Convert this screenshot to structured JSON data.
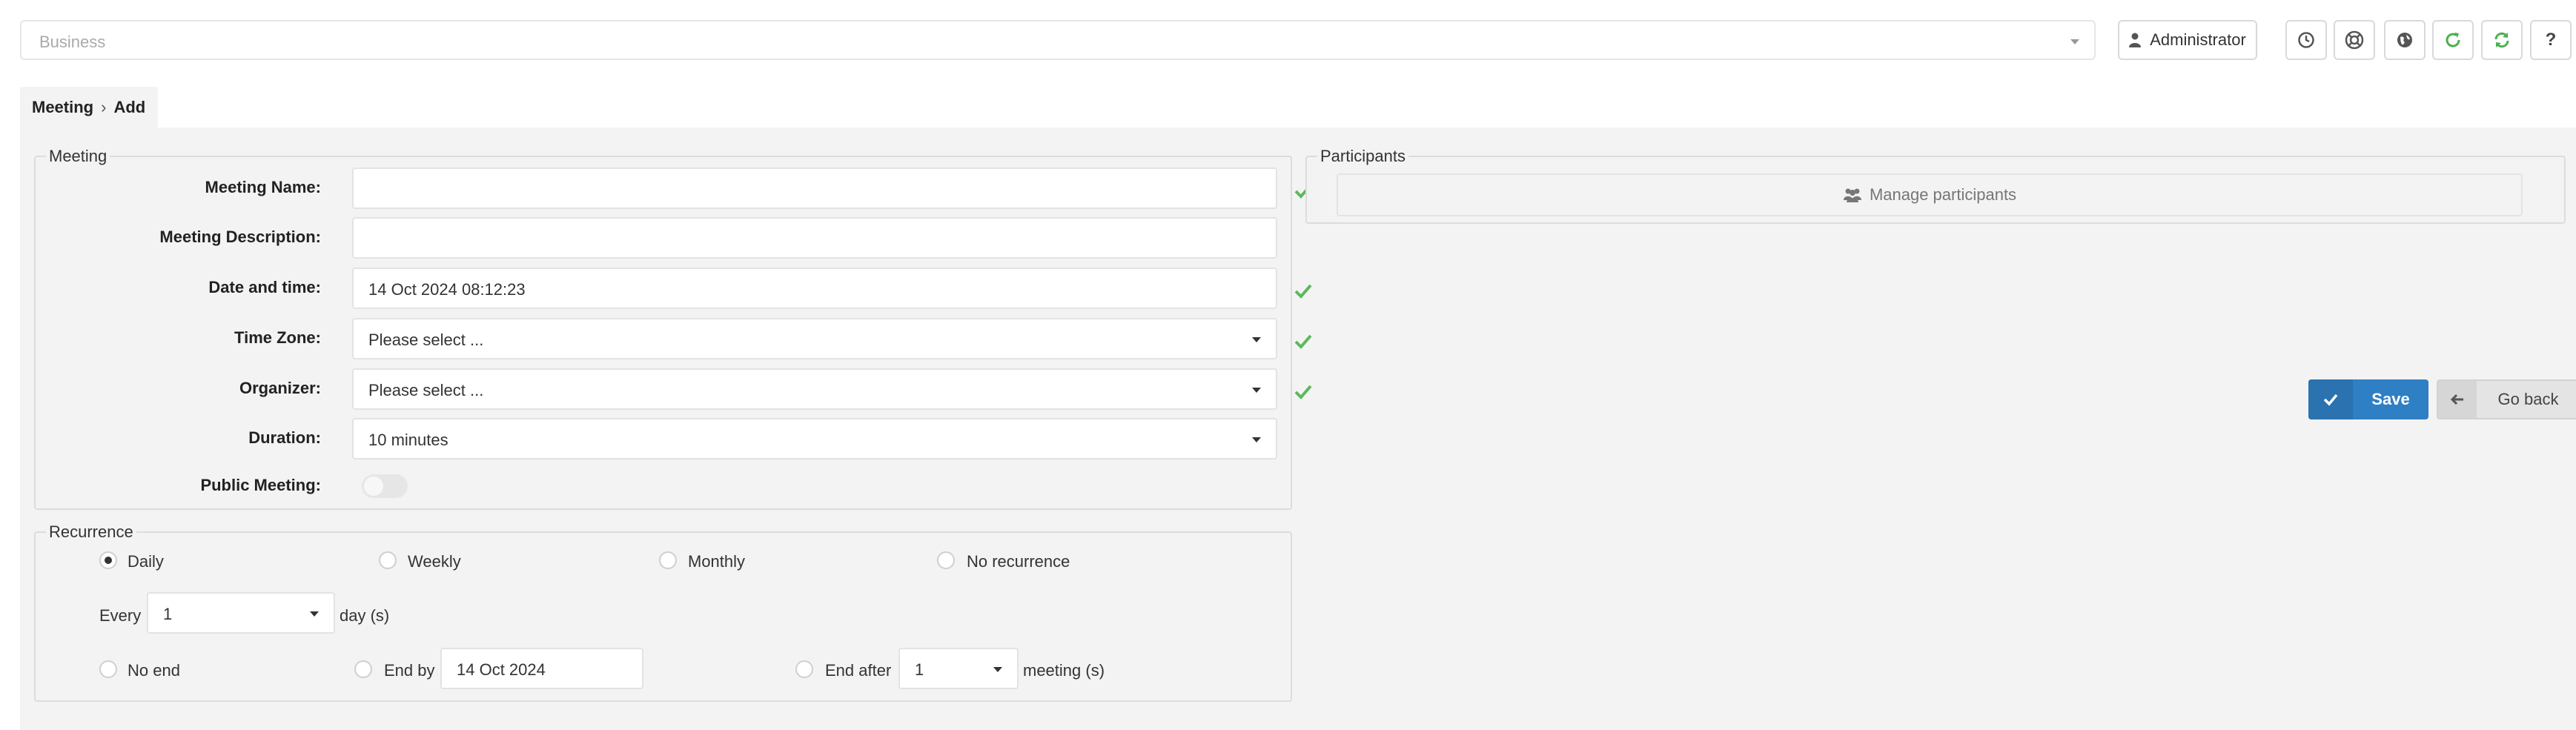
{
  "topbar": {
    "business_placeholder": "Business",
    "user_label": "Administrator",
    "icons": [
      "clock-icon",
      "support-icon",
      "globe-icon",
      "refresh-icon",
      "sync-icon",
      "help-icon"
    ],
    "help_label": "?"
  },
  "breadcrumb": {
    "parent": "Meeting",
    "separator": "›",
    "current": "Add"
  },
  "meeting": {
    "legend": "Meeting",
    "fields": {
      "name_label": "Meeting Name:",
      "name_value": "",
      "description_label": "Meeting Description:",
      "description_value": "",
      "datetime_label": "Date and time:",
      "datetime_value": "14 Oct 2024 08:12:23",
      "timezone_label": "Time Zone:",
      "timezone_value": "Please select ...",
      "organizer_label": "Organizer:",
      "organizer_value": "Please select ...",
      "duration_label": "Duration:",
      "duration_value": "10 minutes",
      "public_label": "Public Meeting:",
      "public_enabled": false
    }
  },
  "recurrence": {
    "legend": "Recurrence",
    "options": [
      "Daily",
      "Weekly",
      "Monthly",
      "No recurrence"
    ],
    "selected": "Daily",
    "every_label": "Every",
    "every_value": "1",
    "every_unit": "day (s)",
    "end_options": {
      "no_end": "No end",
      "end_by": "End by",
      "end_by_value": "14 Oct 2024",
      "end_after": "End after",
      "end_after_value": "1",
      "end_after_unit": "meeting (s)"
    }
  },
  "participants": {
    "legend": "Participants",
    "manage_label": "Manage participants"
  },
  "actions": {
    "save_label": "Save",
    "back_label": "Go back"
  },
  "colors": {
    "primary": "#2f7fc4",
    "success": "#5cb85c",
    "refresh_green": "#4caf50",
    "panel_bg": "#f3f3f3"
  }
}
